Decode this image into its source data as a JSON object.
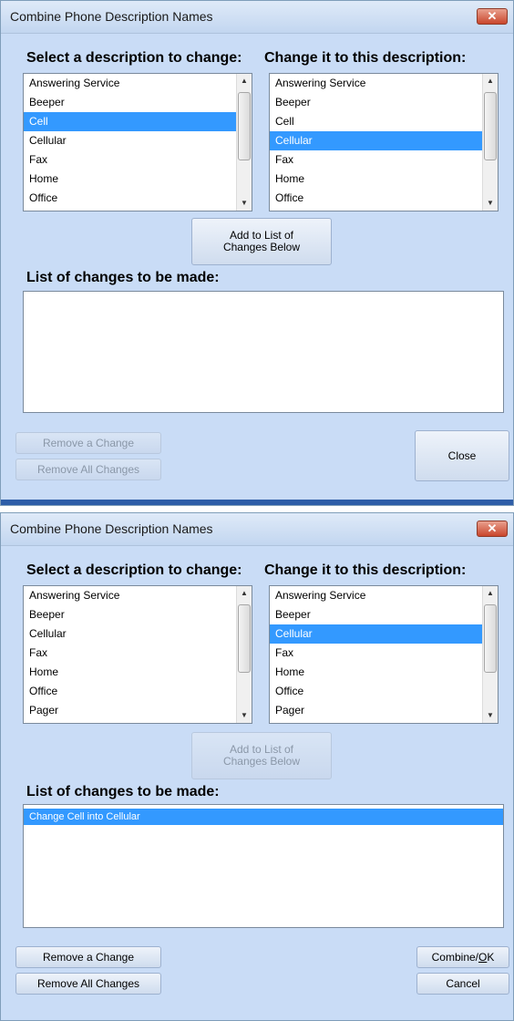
{
  "colors": {
    "dialog_bg": "#c9dcf6",
    "selection": "#3399ff"
  },
  "panel1": {
    "title": "Combine Phone Description Names",
    "close_glyph": "✕",
    "select_label": "Select a description to change:",
    "change_label": "Change it to this description:",
    "left_items": [
      "Answering Service",
      "Beeper",
      "Cell",
      "Cellular",
      "Fax",
      "Home",
      "Office"
    ],
    "left_selected": "Cell",
    "right_items": [
      "Answering Service",
      "Beeper",
      "Cell",
      "Cellular",
      "Fax",
      "Home",
      "Office"
    ],
    "right_selected": "Cellular",
    "add_button_line1": "Add to List of",
    "add_button_line2": "Changes Below",
    "list_label": "List of changes to be made:",
    "changes": [],
    "remove_change": "Remove a Change",
    "remove_all": "Remove All Changes",
    "close": "Close"
  },
  "panel2": {
    "title": "Combine Phone Description Names",
    "close_glyph": "✕",
    "select_label": "Select a description to change:",
    "change_label": "Change it to this description:",
    "left_items": [
      "Answering Service",
      "Beeper",
      "Cellular",
      "Fax",
      "Home",
      "Office",
      "Pager"
    ],
    "right_items": [
      "Answering Service",
      "Beeper",
      "Cellular",
      "Fax",
      "Home",
      "Office",
      "Pager"
    ],
    "right_selected": "Cellular",
    "add_button_line1": "Add to List of",
    "add_button_line2": "Changes Below",
    "list_label": "List of changes to be made:",
    "changes": [
      "Change Cell  into  Cellular"
    ],
    "remove_change": "Remove a Change",
    "remove_all": "Remove All Changes",
    "combine_prefix": "Combine/",
    "combine_underlined": "O",
    "combine_suffix": "K",
    "cancel": "Cancel"
  }
}
